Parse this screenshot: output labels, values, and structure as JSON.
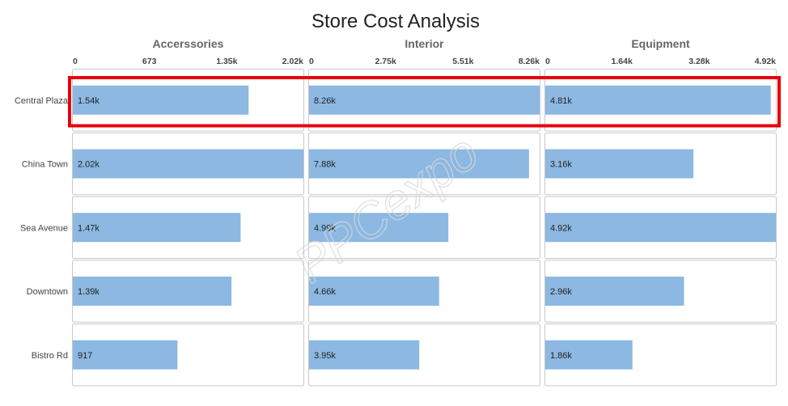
{
  "chart_data": {
    "type": "bar",
    "orientation": "horizontal",
    "title": "Store Cost Analysis",
    "categories": [
      "Central Plaza",
      "China Town",
      "Sea Avenue",
      "Downtown",
      "Bistro Rd"
    ],
    "series": [
      {
        "name": "Accerssories",
        "values": [
          1540,
          2020,
          1470,
          1390,
          917
        ],
        "labels": [
          "1.54k",
          "2.02k",
          "1.47k",
          "1.39k",
          "917"
        ],
        "ticks": [
          "0",
          "673",
          "1.35k",
          "2.02k"
        ],
        "xlim": [
          0,
          2020
        ]
      },
      {
        "name": "Interior",
        "values": [
          8260,
          7880,
          4990,
          4660,
          3950
        ],
        "labels": [
          "8.26k",
          "7.88k",
          "4.99k",
          "4.66k",
          "3.95k"
        ],
        "ticks": [
          "0",
          "2.75k",
          "5.51k",
          "8.26k"
        ],
        "xlim": [
          0,
          8260
        ]
      },
      {
        "name": "Equipment",
        "values": [
          4810,
          3160,
          4920,
          2960,
          1860
        ],
        "labels": [
          "4.81k",
          "3.16k",
          "4.92k",
          "2.96k",
          "1.86k"
        ],
        "ticks": [
          "0",
          "1.64k",
          "3.28k",
          "4.92k"
        ],
        "xlim": [
          0,
          4920
        ]
      }
    ],
    "highlighted_category": "Central Plaza",
    "bar_color": "#8cb8e2",
    "highlight_color": "#e8000b",
    "watermark": "PPCexpo"
  }
}
